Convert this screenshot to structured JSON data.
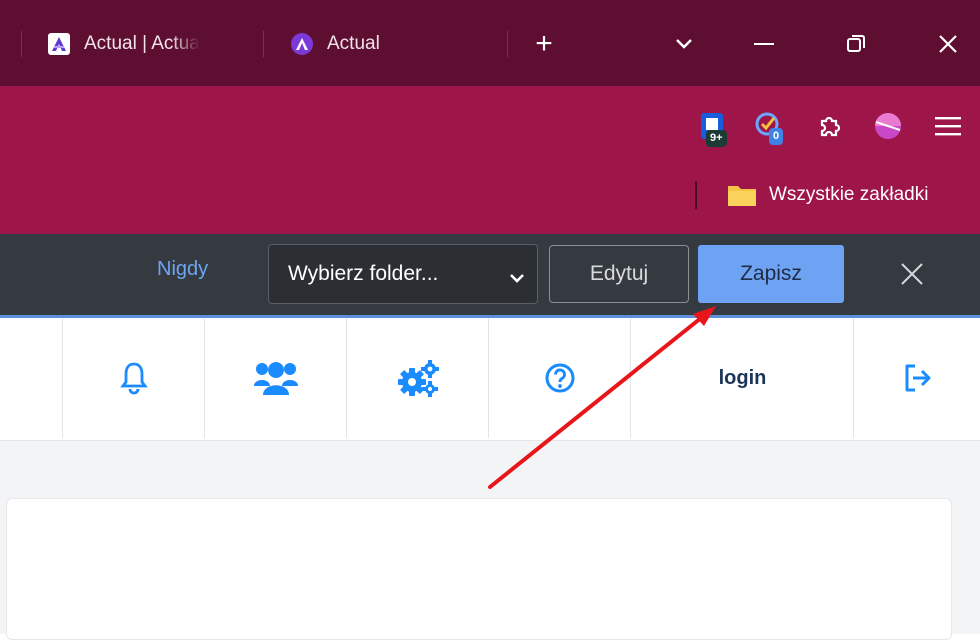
{
  "browser": {
    "tabs": [
      {
        "title": "Actual | Actua",
        "favicon": "actual-logo-icon"
      },
      {
        "title": "Actual",
        "favicon": "actual-a-circle-icon"
      }
    ],
    "new_tab_label": "+",
    "bookmarks_bar": {
      "all_bookmarks_label": "Wszystkie zakładki"
    },
    "extensions": [
      {
        "name": "bitwarden-icon",
        "badge": "9+"
      },
      {
        "name": "checker-icon",
        "badge": "0"
      },
      {
        "name": "extensions-puzzle-icon"
      },
      {
        "name": "profile-avatar-icon"
      },
      {
        "name": "menu-icon"
      }
    ]
  },
  "save_prompt": {
    "never_label": "Nigdy",
    "folder_select": {
      "selected": "Wybierz folder..."
    },
    "edit_label": "Edytuj",
    "save_label": "Zapisz"
  },
  "app_nav": {
    "items": [
      {
        "name": "notifications",
        "icon": "bell-icon"
      },
      {
        "name": "users",
        "icon": "users-icon"
      },
      {
        "name": "settings",
        "icon": "cogs-icon"
      },
      {
        "name": "help",
        "icon": "question-circle-icon"
      },
      {
        "name": "login",
        "label": "login"
      },
      {
        "name": "logout",
        "icon": "sign-out-icon"
      }
    ]
  },
  "colors": {
    "tabstrip_bg": "#5e0e30",
    "toolbar_bg": "#9e1549",
    "savebar_bg": "#353a40",
    "accent_blue": "#6ea3f3",
    "app_icon_blue": "#1a8cff",
    "annotation_arrow": "#e8161b"
  }
}
